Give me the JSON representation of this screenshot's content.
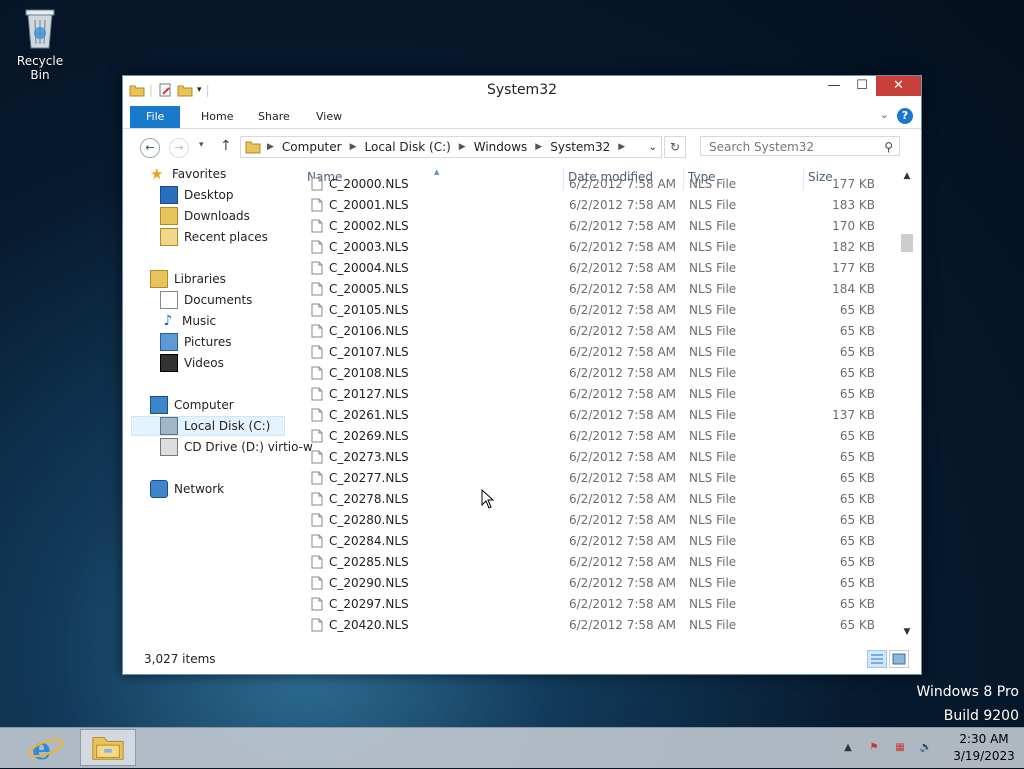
{
  "desktop": {
    "recycle_bin_label": "Recycle Bin"
  },
  "window": {
    "title": "System32",
    "controls": {
      "minimize": "—",
      "maximize": "☐",
      "close": "✕"
    }
  },
  "ribbon": {
    "tabs": [
      "File",
      "Home",
      "Share",
      "View"
    ]
  },
  "address": {
    "crumbs": [
      "Computer",
      "Local Disk (C:)",
      "Windows",
      "System32"
    ],
    "search_placeholder": "Search System32"
  },
  "navpane": {
    "favorites": "Favorites",
    "fav_items": [
      "Desktop",
      "Downloads",
      "Recent places"
    ],
    "libraries": "Libraries",
    "lib_items": [
      "Documents",
      "Music",
      "Pictures",
      "Videos"
    ],
    "computer": "Computer",
    "comp_items": [
      "Local Disk (C:)",
      "CD Drive (D:) virtio-w"
    ],
    "network": "Network"
  },
  "columns": {
    "name": "Name",
    "date": "Date modified",
    "type": "Type",
    "size": "Size"
  },
  "files": [
    {
      "name": "C_20000.NLS",
      "date": "6/2/2012 7:58 AM",
      "type": "NLS File",
      "size": "177 KB"
    },
    {
      "name": "C_20001.NLS",
      "date": "6/2/2012 7:58 AM",
      "type": "NLS File",
      "size": "183 KB"
    },
    {
      "name": "C_20002.NLS",
      "date": "6/2/2012 7:58 AM",
      "type": "NLS File",
      "size": "170 KB"
    },
    {
      "name": "C_20003.NLS",
      "date": "6/2/2012 7:58 AM",
      "type": "NLS File",
      "size": "182 KB"
    },
    {
      "name": "C_20004.NLS",
      "date": "6/2/2012 7:58 AM",
      "type": "NLS File",
      "size": "177 KB"
    },
    {
      "name": "C_20005.NLS",
      "date": "6/2/2012 7:58 AM",
      "type": "NLS File",
      "size": "184 KB"
    },
    {
      "name": "C_20105.NLS",
      "date": "6/2/2012 7:58 AM",
      "type": "NLS File",
      "size": "65 KB"
    },
    {
      "name": "C_20106.NLS",
      "date": "6/2/2012 7:58 AM",
      "type": "NLS File",
      "size": "65 KB"
    },
    {
      "name": "C_20107.NLS",
      "date": "6/2/2012 7:58 AM",
      "type": "NLS File",
      "size": "65 KB"
    },
    {
      "name": "C_20108.NLS",
      "date": "6/2/2012 7:58 AM",
      "type": "NLS File",
      "size": "65 KB"
    },
    {
      "name": "C_20127.NLS",
      "date": "6/2/2012 7:58 AM",
      "type": "NLS File",
      "size": "65 KB"
    },
    {
      "name": "C_20261.NLS",
      "date": "6/2/2012 7:58 AM",
      "type": "NLS File",
      "size": "137 KB"
    },
    {
      "name": "C_20269.NLS",
      "date": "6/2/2012 7:58 AM",
      "type": "NLS File",
      "size": "65 KB"
    },
    {
      "name": "C_20273.NLS",
      "date": "6/2/2012 7:58 AM",
      "type": "NLS File",
      "size": "65 KB"
    },
    {
      "name": "C_20277.NLS",
      "date": "6/2/2012 7:58 AM",
      "type": "NLS File",
      "size": "65 KB"
    },
    {
      "name": "C_20278.NLS",
      "date": "6/2/2012 7:58 AM",
      "type": "NLS File",
      "size": "65 KB"
    },
    {
      "name": "C_20280.NLS",
      "date": "6/2/2012 7:58 AM",
      "type": "NLS File",
      "size": "65 KB"
    },
    {
      "name": "C_20284.NLS",
      "date": "6/2/2012 7:58 AM",
      "type": "NLS File",
      "size": "65 KB"
    },
    {
      "name": "C_20285.NLS",
      "date": "6/2/2012 7:58 AM",
      "type": "NLS File",
      "size": "65 KB"
    },
    {
      "name": "C_20290.NLS",
      "date": "6/2/2012 7:58 AM",
      "type": "NLS File",
      "size": "65 KB"
    },
    {
      "name": "C_20297.NLS",
      "date": "6/2/2012 7:58 AM",
      "type": "NLS File",
      "size": "65 KB"
    },
    {
      "name": "C_20420.NLS",
      "date": "6/2/2012 7:58 AM",
      "type": "NLS File",
      "size": "65 KB"
    }
  ],
  "status": {
    "item_count": "3,027 items"
  },
  "watermark": {
    "line1": "Windows 8 Pro",
    "line2": "Build 9200"
  },
  "clock": {
    "time": "2:30 AM",
    "date": "3/19/2023"
  },
  "colors": {
    "accent": "#1979ca",
    "close": "#c7413a",
    "taskbar": "#bec6ce"
  }
}
